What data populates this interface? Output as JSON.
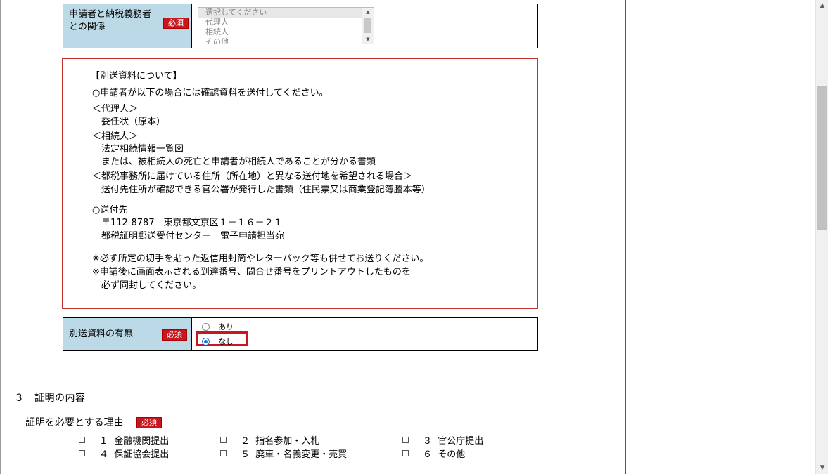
{
  "relationship": {
    "label_line1": "申請者と納税義務者",
    "label_line2": "との関係",
    "required": "必須",
    "options": [
      "選択してください",
      "代理人",
      "相続人",
      "その他"
    ]
  },
  "notice": {
    "heading": "【別送資料について】",
    "intro": "○申請者が以下の場合には確認資料を送付してください。",
    "agent_title": "＜代理人＞",
    "agent_doc": "委任状（原本）",
    "heir_title": "＜相続人＞",
    "heir_doc1": "法定相続情報一覧図",
    "heir_doc2": "または、被相続人の死亡と申請者が相続人であることが分かる書類",
    "address_title": "＜都税事務所に届けている住所（所在地）と異なる送付地を希望される場合＞",
    "address_doc": "送付先住所が確認できる官公署が発行した書類（住民票又は商業登記簿謄本等）",
    "send_title": "○送付先",
    "send_addr": "〒112-8787　東京都文京区１－１６－２１",
    "send_center": "都税証明郵送受付センター　電子申請担当宛",
    "note1": "※必ず所定の切手を貼った返信用封筒やレターパック等も併せてお送りください。",
    "note2": "※申請後に画面表示される到達番号、問合せ番号をプリントアウトしたものを",
    "note3": "必ず同封してください。"
  },
  "separate_docs": {
    "label": "別送資料の有無",
    "required": "必須",
    "option_yes": "あり",
    "option_no": "なし",
    "selected": "なし"
  },
  "section3": {
    "title": "３　証明の内容",
    "reason_title": "証明を必要とする理由",
    "required": "必須",
    "reasons": [
      {
        "num": "１",
        "label": "金融機関提出"
      },
      {
        "num": "２",
        "label": "指名参加・入札"
      },
      {
        "num": "３",
        "label": "官公庁提出"
      },
      {
        "num": "４",
        "label": "保証協会提出"
      },
      {
        "num": "５",
        "label": "廃車・名義変更・売買"
      },
      {
        "num": "６",
        "label": "その他"
      }
    ]
  },
  "icons": {
    "scroll_up": "▲",
    "scroll_down": "▼"
  }
}
